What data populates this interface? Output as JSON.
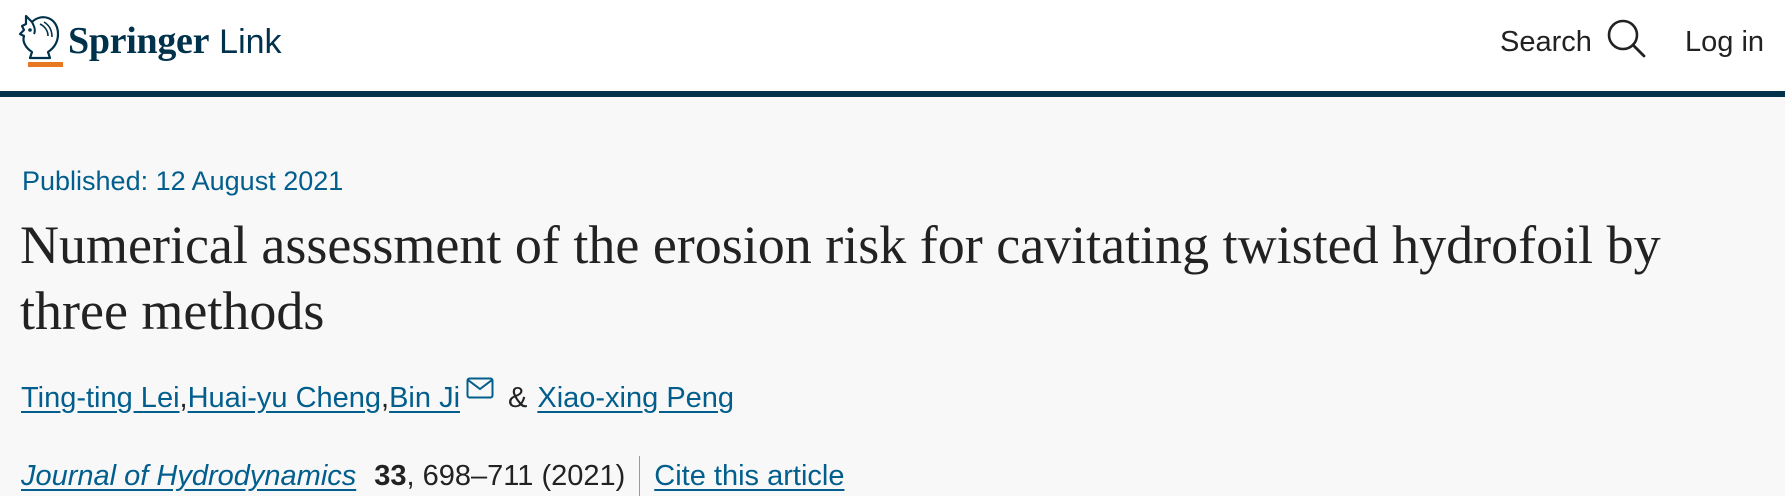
{
  "header": {
    "logo_springer": "Springer",
    "logo_link": "Link",
    "search_label": "Search",
    "login_label": "Log in"
  },
  "article": {
    "published": "Published: 12 August 2021",
    "title": "Numerical assessment of the erosion risk for cavitating twisted hydrofoil by three methods",
    "authors": [
      {
        "name": "Ting-ting Lei",
        "sep": ", "
      },
      {
        "name": "Huai-yu Cheng",
        "sep": ", "
      },
      {
        "name": "Bin Ji",
        "sep": ""
      },
      {
        "name": "Xiao-xing Peng",
        "sep": ""
      }
    ],
    "ampersand": "&",
    "journal": "Journal of Hydrodynamics",
    "volume": "33",
    "pages_year": ", 698–711 (2021)",
    "cite_label": "Cite this article"
  },
  "colors": {
    "brand_navy": "#01324b",
    "brand_orange": "#e87722",
    "link_blue": "#025e8d"
  }
}
